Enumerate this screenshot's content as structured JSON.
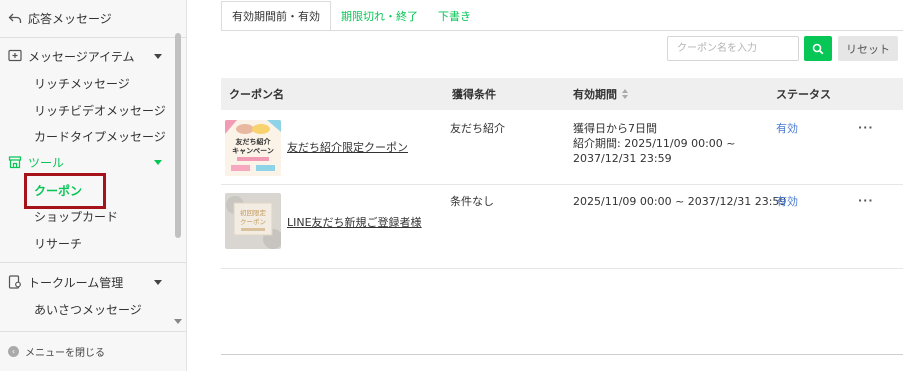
{
  "sidebar": {
    "auto_reply": "応答メッセージ",
    "message_items": {
      "label": "メッセージアイテム",
      "children": [
        "リッチメッセージ",
        "リッチビデオメッセージ",
        "カードタイプメッセージ"
      ]
    },
    "tools": {
      "label": "ツール",
      "children": [
        "クーポン",
        "ショップカード",
        "リサーチ"
      ]
    },
    "talkroom": {
      "label": "トークルーム管理",
      "children": [
        "あいさつメッセージ"
      ]
    },
    "close_menu": "メニューを閉じる"
  },
  "tabs": [
    "有効期間前・有効",
    "期限切れ・終了",
    "下書き"
  ],
  "search": {
    "placeholder": "クーポン名を入力",
    "reset_label": "リセット"
  },
  "table": {
    "headers": [
      "クーポン名",
      "獲得条件",
      "有効期間",
      "ステータス"
    ],
    "rows": [
      {
        "name": "友だち紹介限定クーポン",
        "thumb_text": [
          "友だち紹介",
          "キャンペーン"
        ],
        "condition": "友だち紹介",
        "period_line1": "獲得日から7日間",
        "period_line2": "紹介期間: 2025/11/09 00:00 ~",
        "period_line3": "2037/12/31 23:59",
        "status": "有効",
        "more": "···"
      },
      {
        "name": "LINE友だち新規ご登録者様",
        "thumb_text": [
          "初回限定",
          "クーポン"
        ],
        "condition": "条件なし",
        "period_line1": "2025/11/09 00:00 ~ 2037/12/31 23:59",
        "status": "有効",
        "more": "···"
      }
    ]
  },
  "colors": {
    "accent": "#06c755",
    "highlight_box": "#a6121a",
    "status": "#4a7bd1"
  }
}
